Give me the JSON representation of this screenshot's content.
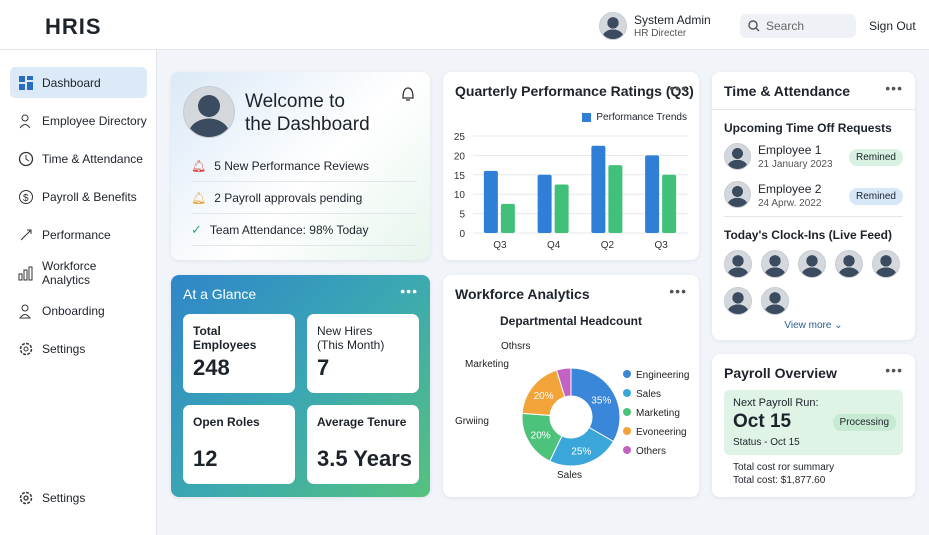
{
  "app": {
    "logo": "HRIS"
  },
  "header": {
    "user_name": "System Admin",
    "user_role": "HR Directer",
    "search_placeholder": "Search",
    "sign_out": "Sign Out"
  },
  "sidebar": {
    "items": [
      {
        "label": "Dashboard",
        "icon": "dashboard-icon"
      },
      {
        "label": "Employee Directory",
        "icon": "users-icon"
      },
      {
        "label": "Time & Attendance",
        "icon": "clock-icon"
      },
      {
        "label": "Payroll & Benefits",
        "icon": "dollar-icon"
      },
      {
        "label": "Performance",
        "icon": "rocket-icon"
      },
      {
        "label": "Workforce Analytics",
        "icon": "bar-chart-icon"
      },
      {
        "label": "Onboarding",
        "icon": "user-add-icon"
      },
      {
        "label": "Settings",
        "icon": "gear-icon"
      }
    ],
    "bottom": "Settings"
  },
  "welcome": {
    "title_line1": "Welcome to",
    "title_line2": "the Dashboard",
    "items": [
      "5 New Performance Reviews",
      "2 Payroll approvals pending",
      "Team Attendance: 98% Today"
    ]
  },
  "glance": {
    "title": "At a Glance",
    "stats": [
      {
        "label": "Total Employees",
        "value": "248"
      },
      {
        "label": "New Hires\n(This Month)",
        "value": "7"
      },
      {
        "label": "Open Roles",
        "value": "12"
      },
      {
        "label": "Average Tenure",
        "value": "3.5 Years"
      }
    ]
  },
  "chart_data": [
    {
      "type": "bar",
      "title": "Quarterly Performance Ratings (Q3)",
      "legend": "Performance Trends",
      "legend_position": "top-right",
      "categories": [
        "Q3",
        "Q4",
        "Q2",
        "Q3"
      ],
      "series": [
        {
          "name": "Performance Trends",
          "color": "#2f7fd6",
          "values": [
            16,
            15,
            22.5,
            20
          ]
        },
        {
          "color": "#41c07a",
          "values": [
            7.5,
            12.5,
            17.5,
            15
          ]
        }
      ],
      "yticks": [
        0,
        5,
        10,
        15,
        20,
        25
      ],
      "ylim": [
        0,
        25
      ],
      "grid": true
    },
    {
      "type": "pie",
      "card_title": "Workforce Analytics",
      "title": "Departmental Headcount",
      "slices": [
        {
          "label": "Sales",
          "pct_label": "35%",
          "value": 35,
          "color": "#3a86d8"
        },
        {
          "label": "Sales",
          "pct_label": "25%",
          "value": 25,
          "color": "#3ba6da"
        },
        {
          "label": "Grwiing",
          "pct_label": "20%",
          "value": 20,
          "color": "#4cc27a"
        },
        {
          "label": "Marketing",
          "pct_label": "20%",
          "value": 20,
          "color": "#f2a33a"
        },
        {
          "label": "Othsrs",
          "pct_label": "",
          "value": 5,
          "color": "#c462c4"
        }
      ],
      "legend": [
        "Engineering",
        "Sales",
        "Marketing",
        "Evoneering",
        "Others"
      ],
      "legend_colors": [
        "#3a86d8",
        "#3ba6da",
        "#4cc27a",
        "#f2a33a",
        "#c462c4"
      ]
    }
  ],
  "time": {
    "title": "Time & Attendance",
    "upcoming": "Upcoming Time Off Requests",
    "requests": [
      {
        "name": "Employee 1",
        "date": "21 January 2023",
        "status": "Remined"
      },
      {
        "name": "Employee 2",
        "date": "24 Aprw. 2022",
        "status": "Remined"
      }
    ],
    "clockins": "Today's Clock-Ins (Live Feed)",
    "view_more": "View more"
  },
  "payroll": {
    "title": "Payroll Overview",
    "next": "Next Payroll Run:",
    "date": "Oct 15",
    "status_badge": "Processing",
    "status": "Status - Oct 15",
    "summary1": "Total cost ror summary",
    "summary2": "Total cost: $1,877.60"
  }
}
